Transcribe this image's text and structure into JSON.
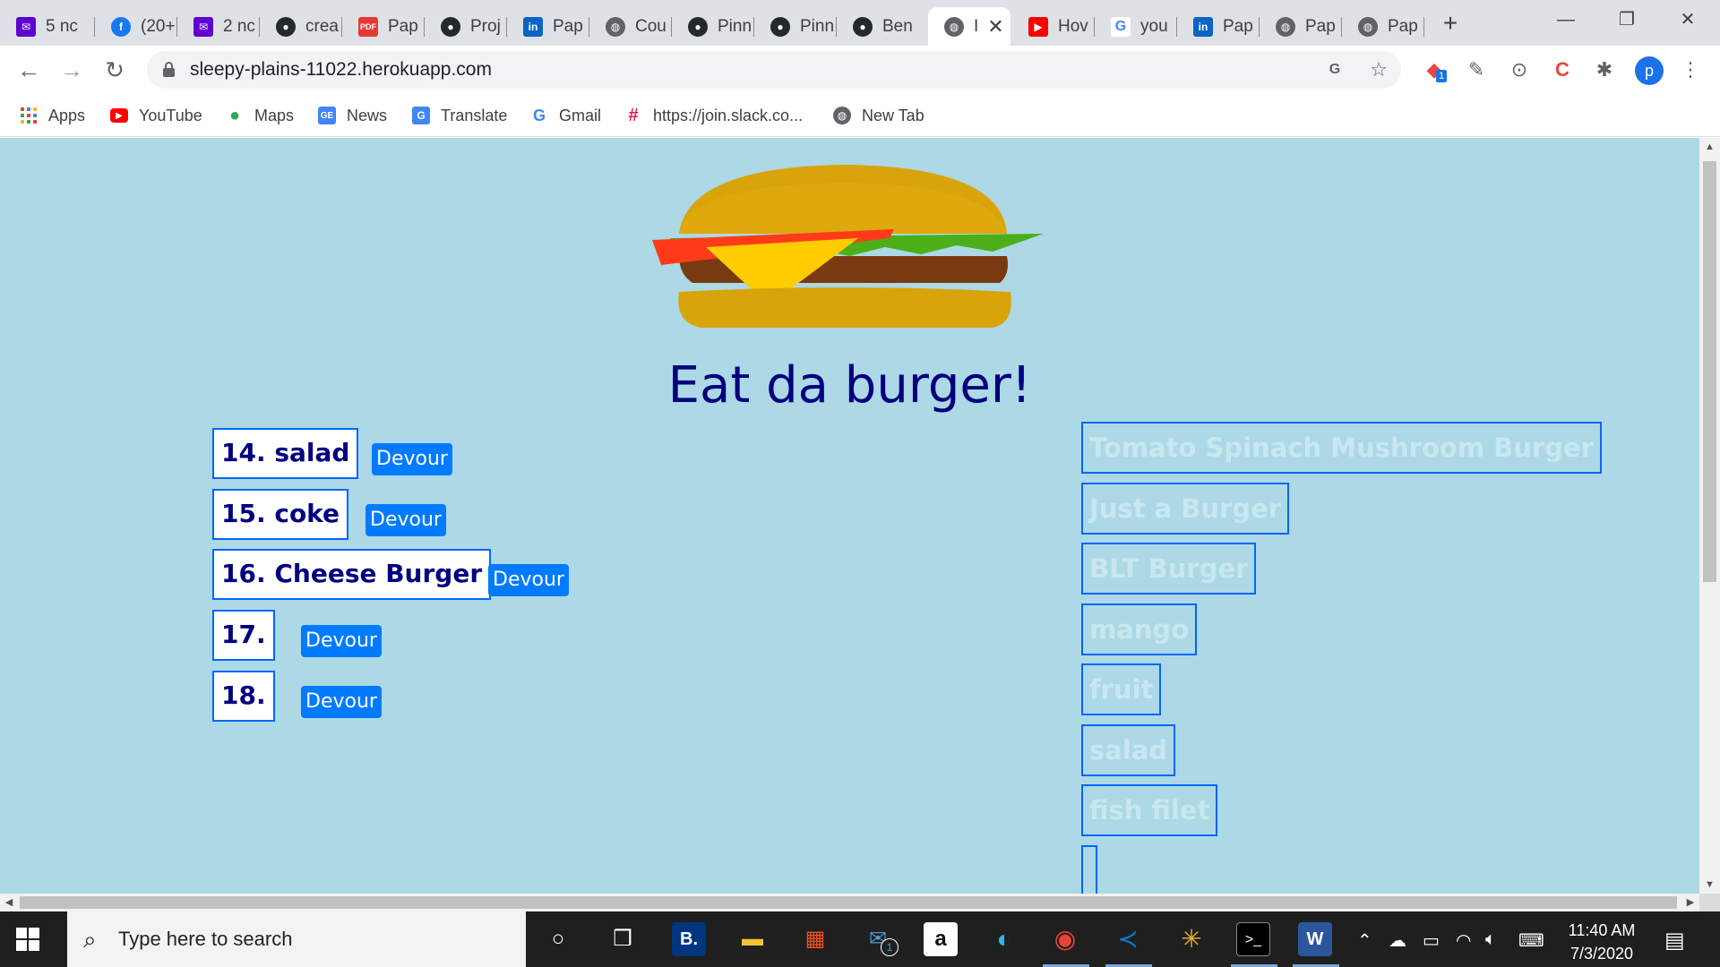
{
  "tabs": [
    {
      "title": "5 nc",
      "icon": "email-icon",
      "color": "#6001d2"
    },
    {
      "title": "(20+",
      "icon": "facebook-icon",
      "color": "#1877f2"
    },
    {
      "title": "2 nc",
      "icon": "email-icon",
      "color": "#6001d2"
    },
    {
      "title": "crea",
      "icon": "github-icon",
      "color": "#24292e"
    },
    {
      "title": "Pap",
      "icon": "pdf-icon",
      "color": "#e53935"
    },
    {
      "title": "Proj",
      "icon": "github-icon",
      "color": "#24292e"
    },
    {
      "title": "Pap",
      "icon": "linkedin-icon",
      "color": "#0a66c2"
    },
    {
      "title": "Cou",
      "icon": "globe-icon",
      "color": "#5f6368"
    },
    {
      "title": "Pinn",
      "icon": "github-icon",
      "color": "#24292e"
    },
    {
      "title": "Pinn",
      "icon": "github-icon",
      "color": "#24292e"
    },
    {
      "title": "Ben",
      "icon": "github-icon",
      "color": "#24292e"
    },
    {
      "title": "I",
      "icon": "globe-icon",
      "color": "#5f6368",
      "active": true
    },
    {
      "title": "Hov",
      "icon": "youtube-icon",
      "color": "#ff0000"
    },
    {
      "title": "you",
      "icon": "google-icon",
      "color": "#4285f4"
    },
    {
      "title": "Pap",
      "icon": "linkedin-icon",
      "color": "#0a66c2"
    },
    {
      "title": "Pap",
      "icon": "globe-icon",
      "color": "#5f6368"
    },
    {
      "title": "Pap",
      "icon": "globe-icon",
      "color": "#5f6368"
    }
  ],
  "toolbar": {
    "url": "sleepy-plains-11022.herokuapp.com",
    "profile_initial": "p",
    "ext_badge": "1"
  },
  "bookmarks": [
    {
      "label": "Apps",
      "icon": "apps-grid-icon"
    },
    {
      "label": "YouTube",
      "icon": "youtube-icon"
    },
    {
      "label": "Maps",
      "icon": "maps-pin-icon"
    },
    {
      "label": "News",
      "icon": "news-icon"
    },
    {
      "label": "Translate",
      "icon": "translate-icon"
    },
    {
      "label": "Gmail",
      "icon": "google-icon"
    },
    {
      "label": "https://join.slack.co...",
      "icon": "slack-icon"
    },
    {
      "label": "New Tab",
      "icon": "globe-icon"
    }
  ],
  "page": {
    "title": "Eat da burger!",
    "devour_label": "Devour",
    "uneaten": [
      {
        "label": "14. salad"
      },
      {
        "label": "15. coke"
      },
      {
        "label": "16. Cheese Burger"
      },
      {
        "label": "17."
      },
      {
        "label": "18."
      }
    ],
    "devoured": [
      {
        "label": "Tomato Spinach Mushroom Burger"
      },
      {
        "label": "Just a Burger"
      },
      {
        "label": "BLT Burger"
      },
      {
        "label": "mango"
      },
      {
        "label": "fruit"
      },
      {
        "label": "salad"
      },
      {
        "label": "fish filet"
      },
      {
        "label": ""
      }
    ]
  },
  "taskbar": {
    "search_placeholder": "Type here to search",
    "time": "11:40 AM",
    "date": "7/3/2020",
    "mail_badge": "1",
    "apps": [
      {
        "name": "cortana-icon"
      },
      {
        "name": "task-view-icon"
      },
      {
        "name": "booking-icon"
      },
      {
        "name": "file-explorer-icon"
      },
      {
        "name": "store-icon"
      },
      {
        "name": "mail-icon"
      },
      {
        "name": "amazon-icon"
      },
      {
        "name": "edge-icon"
      },
      {
        "name": "chrome-icon"
      },
      {
        "name": "vscode-icon"
      },
      {
        "name": "slack-icon"
      },
      {
        "name": "terminal-icon"
      },
      {
        "name": "word-icon"
      }
    ]
  }
}
